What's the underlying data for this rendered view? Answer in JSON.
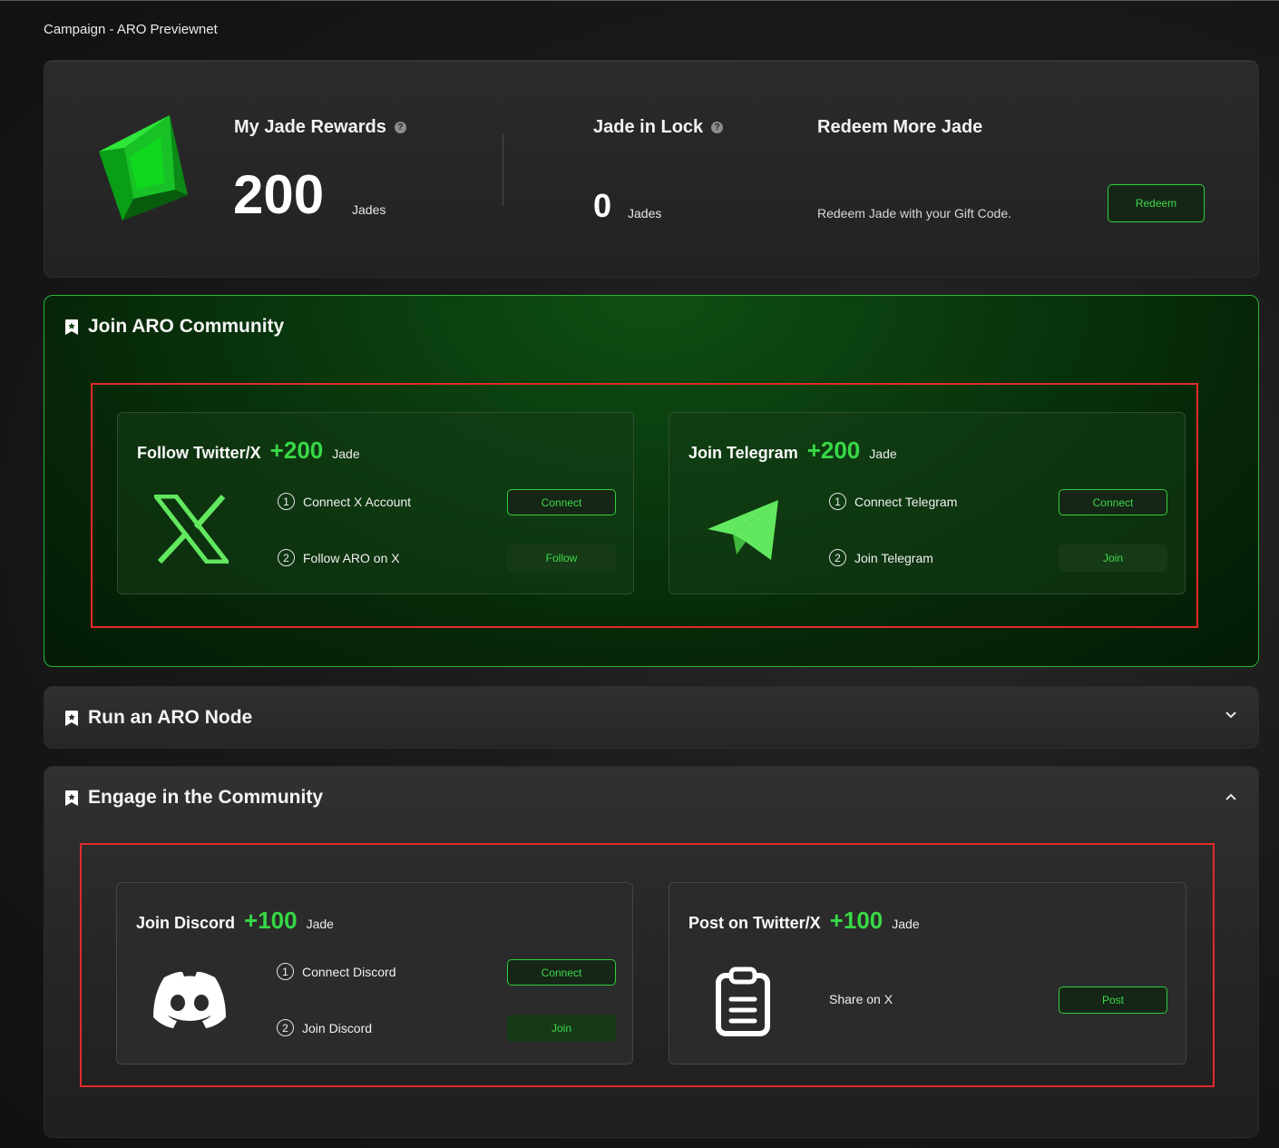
{
  "page": {
    "title": "Campaign - ARO Previewnet"
  },
  "rewards": {
    "my_jade": {
      "label": "My Jade Rewards",
      "help": "?",
      "value": "200",
      "unit": "Jades"
    },
    "locked": {
      "label": "Jade in Lock",
      "help": "?",
      "value": "0",
      "unit": "Jades"
    },
    "redeem": {
      "label": "Redeem More Jade",
      "description": "Redeem Jade with your Gift Code.",
      "button": "Redeem"
    }
  },
  "sections": {
    "community": {
      "title": "Join ARO Community",
      "cards": {
        "twitter": {
          "name": "Follow Twitter/X",
          "amount": "+200",
          "unit": "Jade",
          "steps": [
            {
              "num": "1",
              "label": "Connect X Account",
              "button": "Connect"
            },
            {
              "num": "2",
              "label": "Follow ARO on X",
              "button": "Follow"
            }
          ]
        },
        "telegram": {
          "name": "Join Telegram",
          "amount": "+200",
          "unit": "Jade",
          "steps": [
            {
              "num": "1",
              "label": "Connect Telegram",
              "button": "Connect"
            },
            {
              "num": "2",
              "label": "Join Telegram",
              "button": "Join"
            }
          ]
        }
      }
    },
    "node": {
      "title": "Run an ARO Node"
    },
    "engage": {
      "title": "Engage in the Community",
      "cards": {
        "discord": {
          "name": "Join Discord",
          "amount": "+100",
          "unit": "Jade",
          "steps": [
            {
              "num": "1",
              "label": "Connect Discord",
              "button": "Connect"
            },
            {
              "num": "2",
              "label": "Join Discord",
              "button": "Join"
            }
          ]
        },
        "post": {
          "name": "Post on Twitter/X",
          "amount": "+100",
          "unit": "Jade",
          "action": {
            "label": "Share on X",
            "button": "Post"
          }
        }
      }
    }
  },
  "colors": {
    "accent": "#37d846",
    "highlight_box": "#e02b2b"
  }
}
